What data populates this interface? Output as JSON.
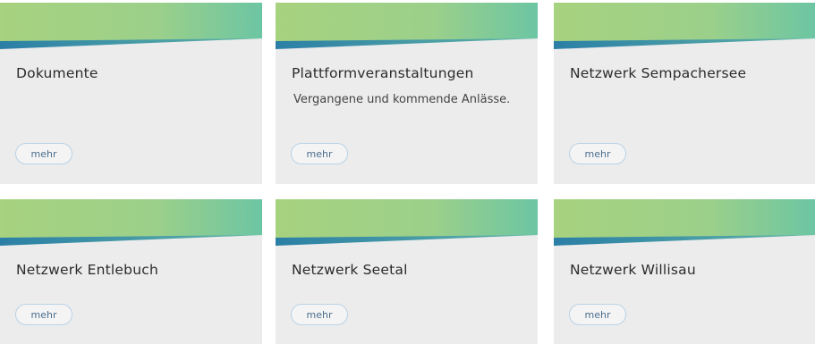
{
  "colors": {
    "card_background": "#ececec",
    "banner_green_light": "#a7d27f",
    "banner_green_teal": "#6cc5a3",
    "banner_blue": "#2b7fa6",
    "button_border": "#b9d2e6",
    "button_text": "#4a6d8e"
  },
  "cards": [
    {
      "title": "Dokumente",
      "description": "",
      "button_label": "mehr"
    },
    {
      "title": "Plattformveranstaltungen",
      "description": "Vergangene und kommende Anlässe.",
      "button_label": "mehr"
    },
    {
      "title": "Netzwerk Sempachersee",
      "description": "",
      "button_label": "mehr"
    },
    {
      "title": "Netzwerk Entlebuch",
      "description": "",
      "button_label": "mehr"
    },
    {
      "title": "Netzwerk Seetal",
      "description": "",
      "button_label": "mehr"
    },
    {
      "title": "Netzwerk Willisau",
      "description": "",
      "button_label": "mehr"
    }
  ]
}
